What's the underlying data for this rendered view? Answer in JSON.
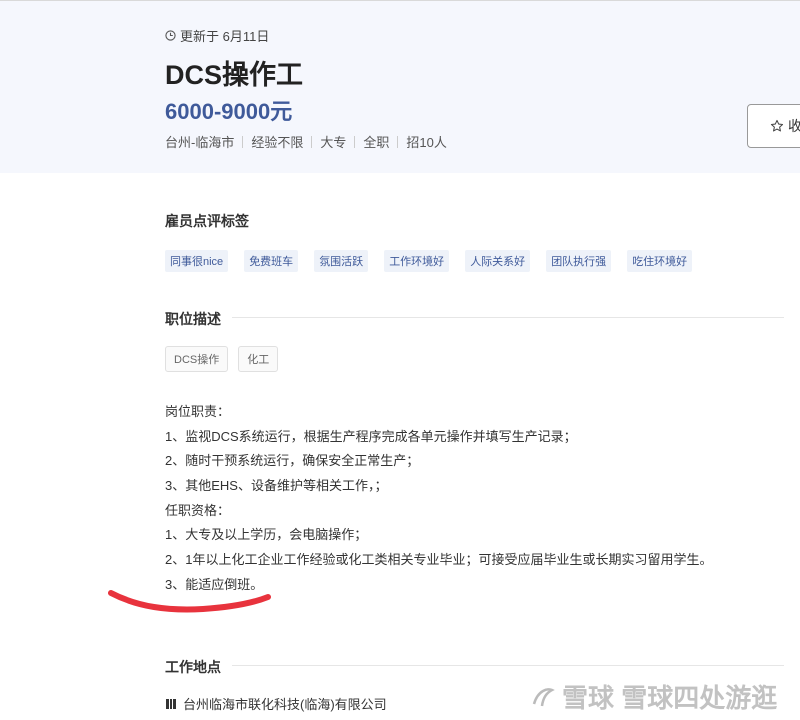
{
  "header": {
    "updated": "更新于  6月11日",
    "title": "DCS操作工",
    "salary": "6000-9000元",
    "meta": [
      "台州-临海市",
      "经验不限",
      "大专",
      "全职",
      "招10人"
    ],
    "favorite_label": "收"
  },
  "review_tags": {
    "title": "雇员点评标签",
    "tags": [
      "同事很nice",
      "免费班车",
      "氛围活跃",
      "工作环境好",
      "人际关系好",
      "团队执行强",
      "吃住环境好"
    ]
  },
  "job_description": {
    "title": "职位描述",
    "skills": [
      "DCS操作",
      "化工"
    ],
    "lines": [
      "岗位职责：",
      "1、监视DCS系统运行，根据生产程序完成各单元操作并填写生产记录；",
      "2、随时干预系统运行，确保安全正常生产；",
      "3、其他EHS、设备维护等相关工作，；",
      "任职资格：",
      "1、大专及以上学历，会电脑操作；",
      "2、1年以上化工企业工作经验或化工类相关专业毕业；可接受应届毕业生或长期实习留用学生。",
      "3、能适应倒班。"
    ]
  },
  "work_location": {
    "title": "工作地点",
    "company": "台州临海市联化科技(临海)有限公司"
  },
  "watermark": {
    "text": "雪球 雪球四处游逛"
  },
  "colors": {
    "accent": "#3f5a9a",
    "header_bg": "#f5f7fd",
    "tag_bg": "#eef2f9",
    "annotation_red": "#e8333d"
  }
}
